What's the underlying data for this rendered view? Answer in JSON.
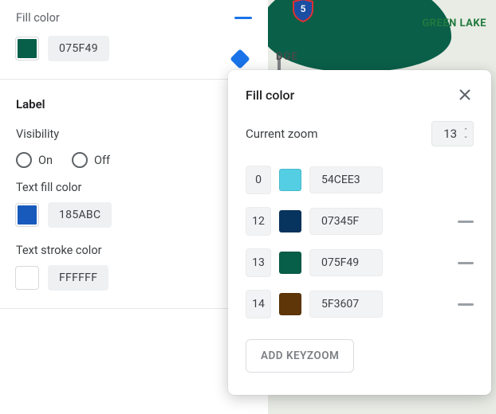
{
  "panel": {
    "fill": {
      "title": "Fill color",
      "hex": "075F49",
      "color": "#075F49"
    },
    "label": {
      "title": "Label",
      "visibility": "Visibility",
      "on": "On",
      "off": "Off",
      "textFill": {
        "label": "Text fill color",
        "hex": "185ABC",
        "color": "#185ABC"
      },
      "textStroke": {
        "label": "Text stroke color",
        "hex": "FFFFFF",
        "color": "#FFFFFF"
      }
    }
  },
  "map": {
    "greenlake": "GREEN LAKE",
    "dge": "DGE",
    "highway": "5"
  },
  "popover": {
    "title": "Fill color",
    "zoomLabel": "Current zoom",
    "zoomValue": "13",
    "stops": [
      {
        "zoom": "0",
        "hex": "54CEE3",
        "color": "#54CEE3",
        "removable": false
      },
      {
        "zoom": "12",
        "hex": "07345F",
        "color": "#07345F",
        "removable": true
      },
      {
        "zoom": "13",
        "hex": "075F49",
        "color": "#075F49",
        "removable": true
      },
      {
        "zoom": "14",
        "hex": "5F3607",
        "color": "#5F3607",
        "removable": true
      }
    ],
    "addKeyzoom": "ADD KEYZOOM"
  }
}
